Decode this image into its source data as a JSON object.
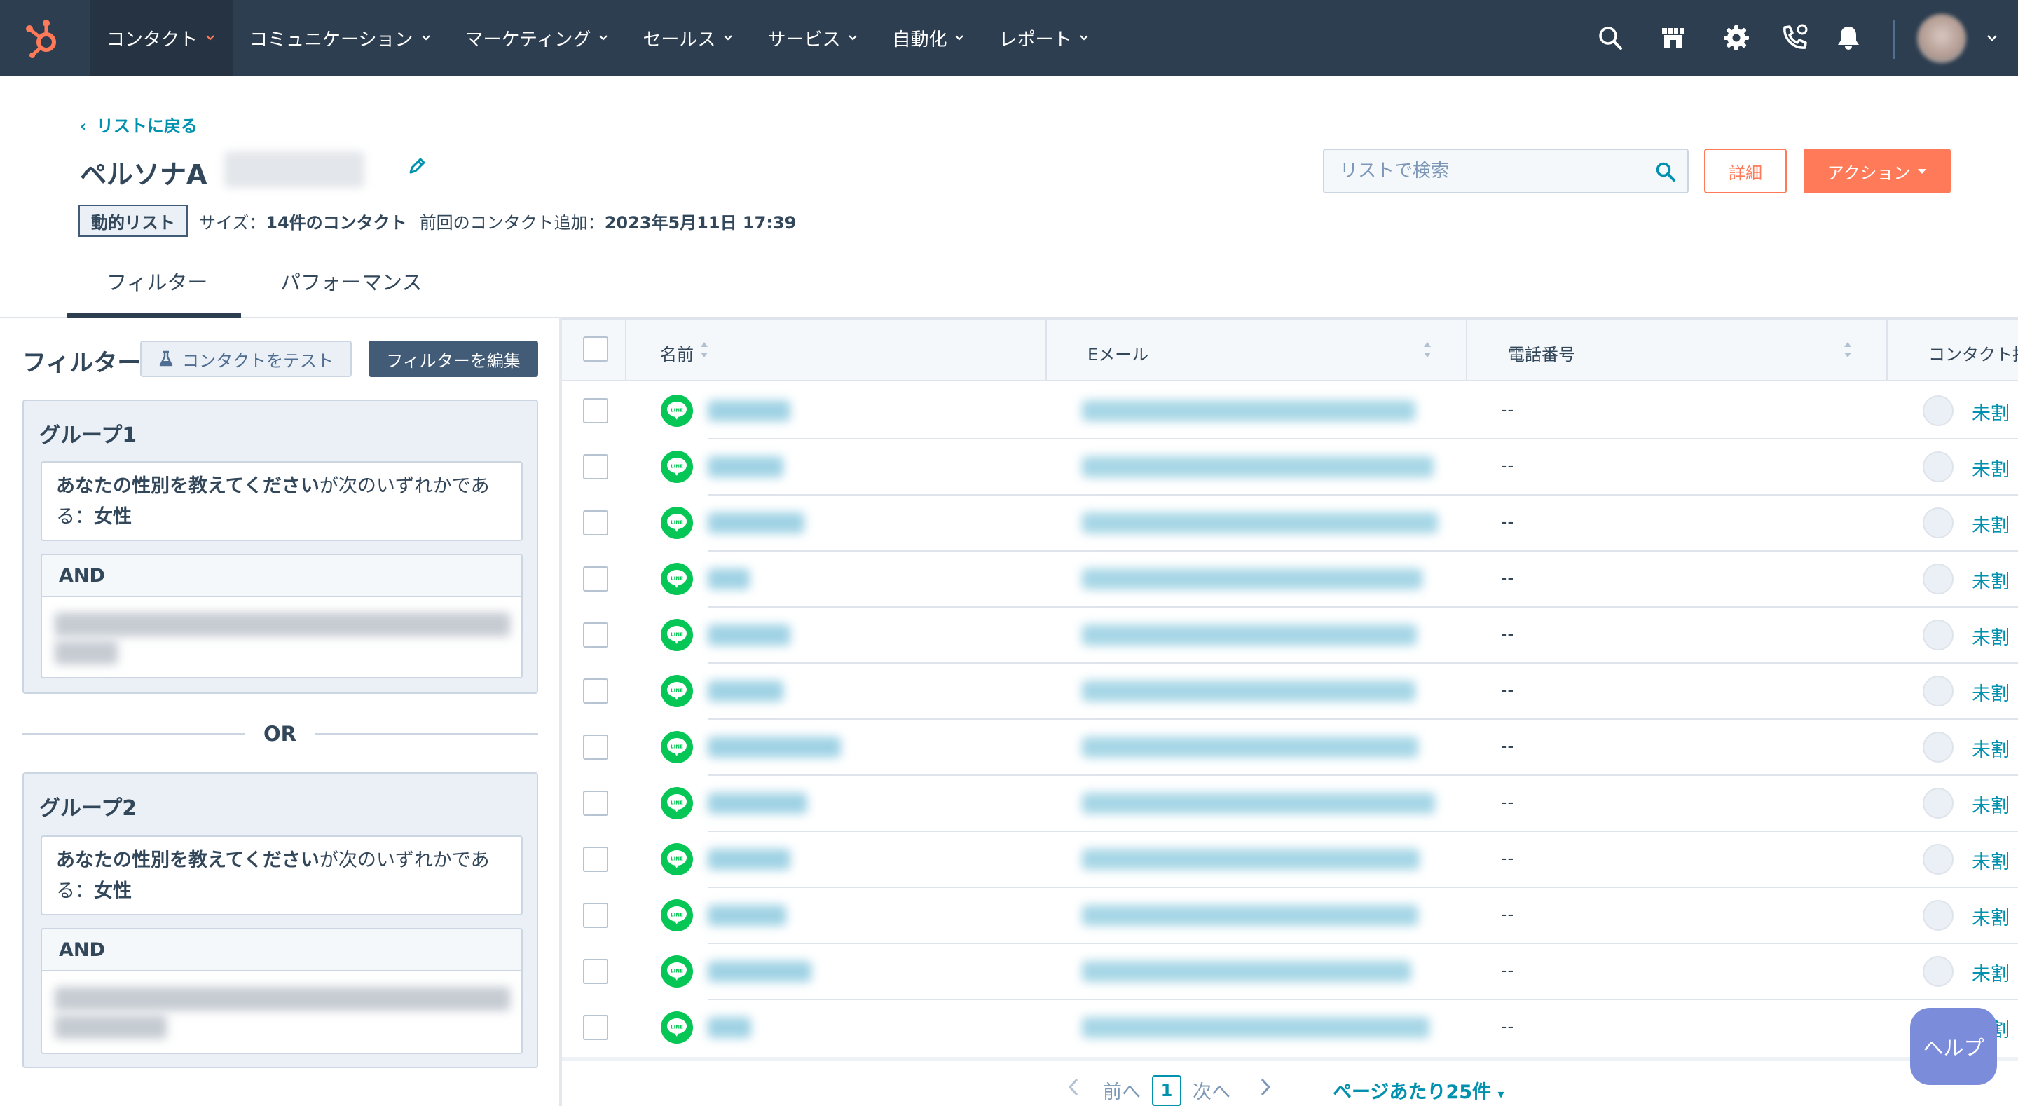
{
  "nav": {
    "items": [
      {
        "label": "コンタクト",
        "active": true
      },
      {
        "label": "コミュニケーション"
      },
      {
        "label": "マーケティング"
      },
      {
        "label": "セールス"
      },
      {
        "label": "サービス"
      },
      {
        "label": "自動化"
      },
      {
        "label": "レポート"
      }
    ],
    "icons": [
      "search-icon",
      "marketplace-icon",
      "settings-gear-icon",
      "calling-icon",
      "notification-bell-icon"
    ]
  },
  "header": {
    "back_link": "リストに戻る",
    "title": "ペルソナA",
    "list_type": "動的リスト",
    "size_label": "サイズ：",
    "size_value": "14件のコンタクト",
    "last_added_label": "前回のコンタクト追加：",
    "last_added_value": "2023年5月11日 17:39",
    "search_placeholder": "リストで検索",
    "details_button": "詳細",
    "actions_button": "アクション"
  },
  "tabs": [
    "フィルター",
    "パフォーマンス"
  ],
  "filters": {
    "title": "フィルター",
    "test_button": "コンタクトをテスト",
    "edit_button": "フィルターを編集",
    "or_label": "OR",
    "groups": [
      {
        "title": "グループ1",
        "condition_property": "あなたの性別を教えてください",
        "condition_operator": "が次のいずれかである：",
        "condition_value": "女性",
        "and_label": "AND"
      },
      {
        "title": "グループ2",
        "condition_property": "あなたの性別を教えてください",
        "condition_operator": "が次のいずれかである：",
        "condition_value": "女性",
        "and_label": "AND"
      }
    ]
  },
  "table": {
    "columns": [
      "名前",
      "Eメール",
      "電話番号",
      "コンタクト担"
    ],
    "rows": [
      {
        "phone": "--",
        "owner": "未割"
      },
      {
        "phone": "--",
        "owner": "未割"
      },
      {
        "phone": "--",
        "owner": "未割"
      },
      {
        "phone": "--",
        "owner": "未割"
      },
      {
        "phone": "--",
        "owner": "未割"
      },
      {
        "phone": "--",
        "owner": "未割"
      },
      {
        "phone": "--",
        "owner": "未割"
      },
      {
        "phone": "--",
        "owner": "未割"
      },
      {
        "phone": "--",
        "owner": "未割"
      },
      {
        "phone": "--",
        "owner": "未割"
      },
      {
        "phone": "--",
        "owner": "未割"
      },
      {
        "phone": "--",
        "owner": "未割"
      }
    ]
  },
  "pagination": {
    "prev": "前へ",
    "current": "1",
    "next": "次へ",
    "per_page": "ページあたり25件"
  },
  "help_button": "ヘルプ",
  "colors": {
    "nav_bg": "#2d3e50",
    "accent": "#ff7a59",
    "link": "#0091ae",
    "line_green": "#06c755"
  }
}
